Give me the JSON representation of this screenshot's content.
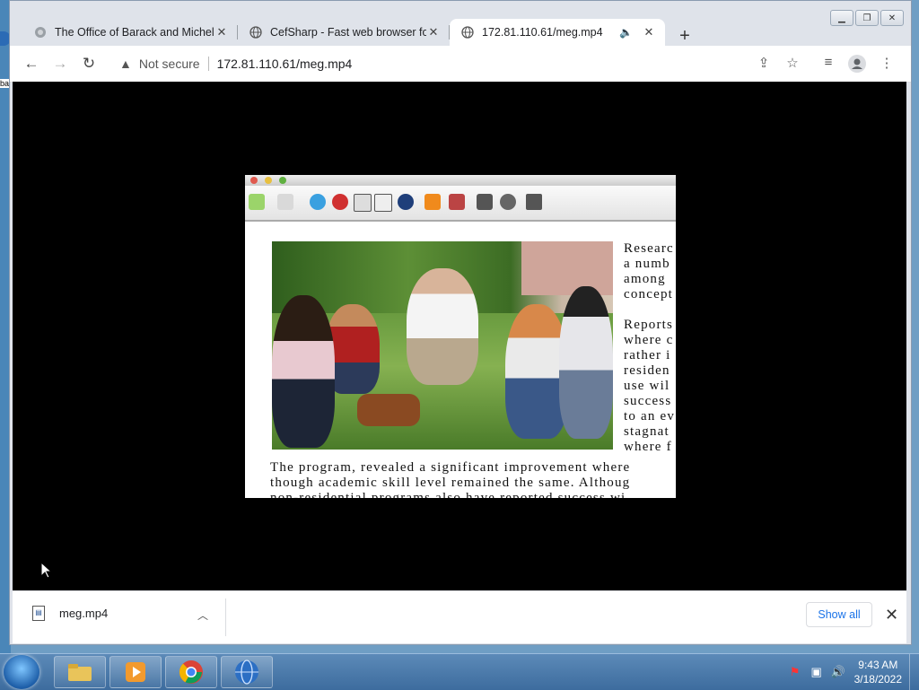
{
  "browser": {
    "tabs": [
      {
        "title": "The Office of Barack and Michelle",
        "close": "✕"
      },
      {
        "title": "CefSharp - Fast web browser for",
        "close": "✕"
      },
      {
        "title": "172.81.110.61/meg.mp4",
        "close": "✕",
        "audio": "🔈"
      }
    ],
    "new_tab": "+",
    "security_label": "Not secure",
    "url": "172.81.110.61/meg.mp4"
  },
  "video_text": {
    "right_col": "Researc\na numb\namong\nconcept\n\nReports\nwhere c\nrather i\nresiden\nuse wil\nsuccess\nto an ev\nstagnat\nwhere f",
    "bottom": "The program, revealed a significant improvement where\nthough academic skill level remained the same. Althoug\nnon-residential programs also have reported success wi"
  },
  "downloads": {
    "filename": "meg.mp4",
    "show_all": "Show all",
    "close": "✕"
  },
  "taskbar": {
    "time": "9:43 AM",
    "date": "3/18/2022"
  },
  "desktop": {
    "icon_label": "ba"
  }
}
